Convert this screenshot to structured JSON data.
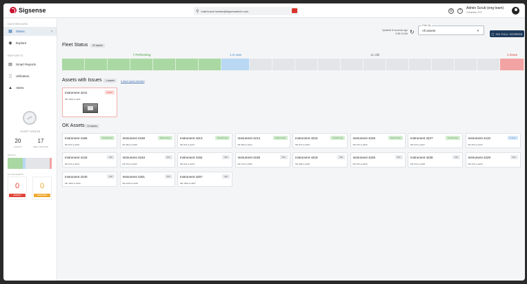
{
  "topbar": {
    "brand": "Sigsense",
    "search_text": "matt.busch+admin@sigsensetech.com",
    "user_name": "Admin Scrub (eng team)",
    "user_company": "Company XYZ",
    "icons": [
      "search-icon",
      "chat-icon",
      "gear-icon",
      "help-icon",
      "avatar-icon"
    ]
  },
  "sidebar": {
    "dashboard_header": "DASHBOARD",
    "reports_header": "REPORTS",
    "items": [
      {
        "label": "Status",
        "icon": "grid-icon",
        "active": true
      },
      {
        "label": "Explore",
        "icon": "compass-icon",
        "active": false
      },
      {
        "label": "Smart Reports",
        "icon": "report-icon",
        "active": false
      },
      {
        "label": "Utilization",
        "icon": "bar-chart-icon",
        "active": false
      },
      {
        "label": "Alerts",
        "icon": "warning-icon",
        "active": false
      }
    ],
    "fleet_status_title": "FLEET STATUS",
    "assets_count": "20",
    "assets_label": "ASSETS",
    "meet_demand_count": "17",
    "meet_demand_label": "MEET DEMAND",
    "status_label": "STATUS",
    "active_alerts_label": "ACTIVE ALERTS",
    "alerts": [
      {
        "count": "0",
        "tag": "ERROR",
        "color": "#e0463a"
      },
      {
        "count": "0",
        "tag": "WARNING",
        "color": "#f0a830"
      }
    ]
  },
  "header": {
    "updated_text": "Updated 8 seconds ago",
    "updated_time": "9:08:13 AM",
    "filter_label": "Filter By",
    "filter_value": "All assets",
    "full_screen_label": "GO FULL SCREEN"
  },
  "fleet": {
    "title": "Fleet Status",
    "count_badge": "20 assets",
    "performing_label": "7 Performing",
    "in_use_label": "1 In Use",
    "idle_label": "11 Idle",
    "down_label": "1 Down",
    "performing_count": 7,
    "in_use_count": 1,
    "idle_count": 11,
    "down_count": 1,
    "colors": {
      "performing": "#a9d8a2",
      "in_use": "#b9d8f3",
      "idle": "#e3e5e8",
      "down": "#f2a3a3"
    }
  },
  "issues": {
    "title": "Assets with Issues",
    "count_badge": "1 assets",
    "link_text": "0 issue types selected",
    "cards": [
      {
        "name": "Instrument 4241",
        "serial": "MF-1002-A-4241",
        "status": "Down"
      }
    ]
  },
  "ok_assets": {
    "title": "OK Assets",
    "count_badge": "19 assets",
    "cards": [
      {
        "name": "Instrument 4166",
        "serial": "MF-973-A-4166",
        "status": "Performing"
      },
      {
        "name": "Instrument 4168",
        "serial": "MF-994-A-4168",
        "status": "Performing"
      },
      {
        "name": "Instrument 4213",
        "serial": "MF-973-A-4213",
        "status": "Performing"
      },
      {
        "name": "Instrument 4214",
        "serial": "MF-994-A-4214",
        "status": "Performing"
      },
      {
        "name": "Instrument 4215",
        "serial": "MF-973-A-4215",
        "status": "Performing"
      },
      {
        "name": "Instrument 4226",
        "serial": "MF-973-A-4226",
        "status": "Performing"
      },
      {
        "name": "Instrument 4227",
        "serial": "MF-973-A-4227",
        "status": "Performing"
      },
      {
        "name": "Instrument 4132",
        "serial": "MF-973-A-4132",
        "status": "In Use"
      },
      {
        "name": "Instrument 4133",
        "serial": "MF-973-A-4133",
        "status": "Idle"
      },
      {
        "name": "Instrument 4163",
        "serial": "MF-973-A-4163",
        "status": "Idle"
      },
      {
        "name": "Instrument 4164",
        "serial": "MF-973-A-4164",
        "status": "Idle"
      },
      {
        "name": "Instrument 4165",
        "serial": "MF-973-A-4165",
        "status": "Idle"
      },
      {
        "name": "Instrument 4218",
        "serial": "MF-995-A-4218",
        "status": "Idle"
      },
      {
        "name": "Instrument 4225",
        "serial": "MF-973-A-4225",
        "status": "Idle"
      },
      {
        "name": "Instrument 4228",
        "serial": "MF-973-A-4228",
        "status": "Idle"
      },
      {
        "name": "Instrument 4229",
        "serial": "MF-973-A-4229",
        "status": "Idle"
      },
      {
        "name": "Instrument 4240",
        "serial": "MF-1002-A-4240",
        "status": "Idle"
      },
      {
        "name": "Instrument 4251",
        "serial": "MF-1002-A-4251",
        "status": "Idle"
      },
      {
        "name": "Instrument 4257",
        "serial": "MF-1002-A-4257",
        "status": "Idle"
      }
    ]
  }
}
